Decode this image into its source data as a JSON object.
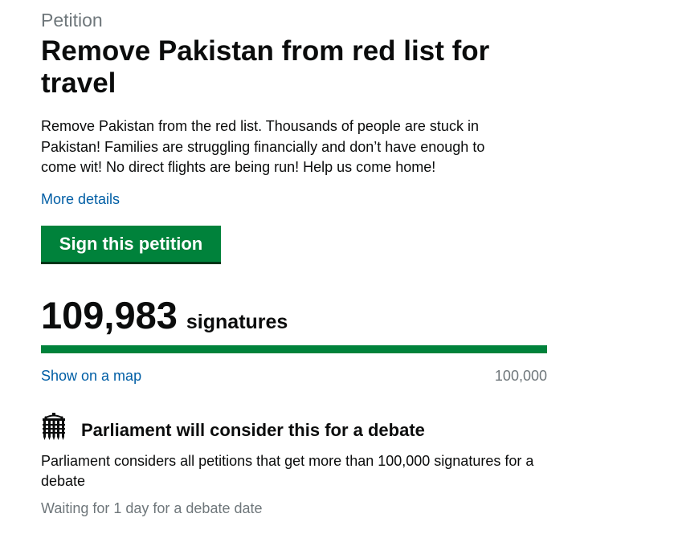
{
  "petition": {
    "caption": "Petition",
    "title": "Remove Pakistan from red list for travel",
    "summary": "Remove Pakistan from the red list. Thousands of people are stuck in Pakistan! Families are struggling financially and don’t have enough to come wit! No direct flights are being run! Help us come home!",
    "more_details_label": "More details",
    "sign_button_label": "Sign this petition"
  },
  "signatures": {
    "count": "109,983",
    "label": "signatures",
    "progress_fraction": 1.0,
    "show_map_label": "Show on a map",
    "target": "100,000"
  },
  "debate": {
    "icon": "portcullis-icon",
    "heading": "Parliament will consider this for a debate",
    "text": "Parliament considers all petitions that get more than 100,000 signatures for a debate",
    "status": "Waiting for 1 day for a debate date"
  },
  "colors": {
    "button_green": "#00823b",
    "progress_green": "#00823b",
    "link_blue": "#005ea5",
    "secondary_grey": "#6f777b",
    "text_black": "#0b0c0c"
  }
}
